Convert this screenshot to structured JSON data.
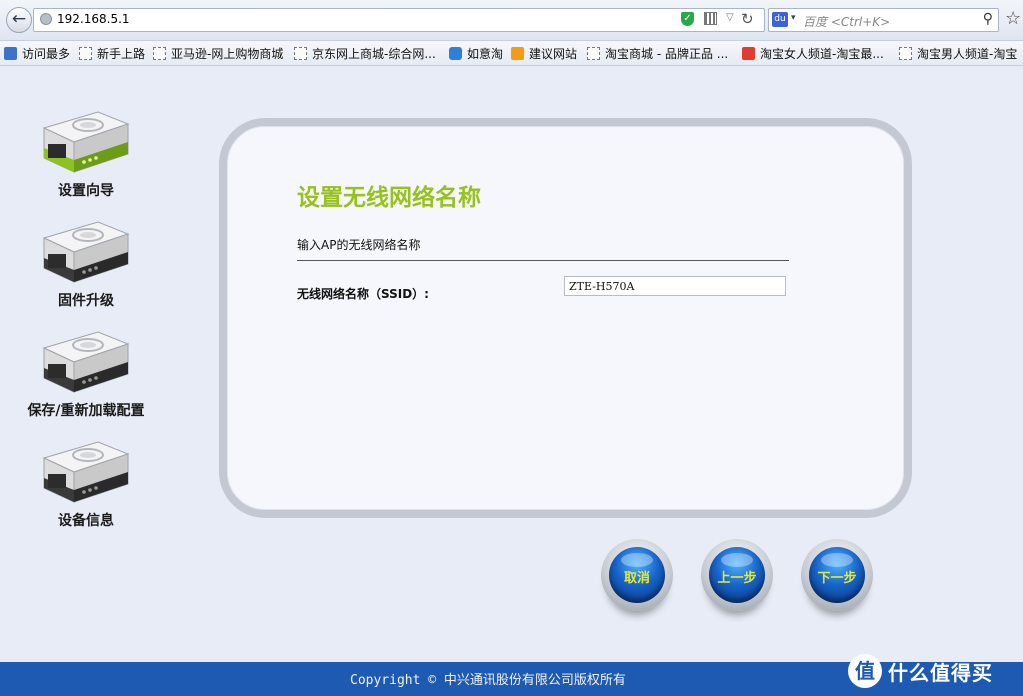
{
  "browser": {
    "url": "192.168.5.1",
    "search_placeholder": "百度 <Ctrl+K>",
    "search_engine_icon": "baidu-paw-icon"
  },
  "bookmarks": [
    {
      "label": "访问最多",
      "icon": "reader-icon"
    },
    {
      "label": "新手上路",
      "icon": "page-icon"
    },
    {
      "label": "亚马逊-网上购物商城",
      "icon": "page-icon"
    },
    {
      "label": "京东网上商城-综合网...",
      "icon": "page-icon"
    },
    {
      "label": "如意淘",
      "icon": "ruyitao-icon"
    },
    {
      "label": "建议网站",
      "icon": "bulb-icon"
    },
    {
      "label": "淘宝商城 - 品牌正品 ...",
      "icon": "page-icon"
    },
    {
      "label": "淘宝女人频道-淘宝最...",
      "icon": "taobao-icon"
    },
    {
      "label": "淘宝男人频道-淘宝",
      "icon": "page-icon"
    }
  ],
  "sidebar": {
    "items": [
      {
        "label": "设置向导",
        "active": true
      },
      {
        "label": "固件升级",
        "active": false
      },
      {
        "label": "保存/重新加载配置",
        "active": false
      },
      {
        "label": "设备信息",
        "active": false
      }
    ]
  },
  "main": {
    "title": "设置无线网络名称",
    "description": "输入AP的无线网络名称",
    "ssid_label": "无线网络名称（SSID）:",
    "ssid_value": "ZTE-H570A"
  },
  "buttons": {
    "cancel": "取消",
    "prev": "上一步",
    "next": "下一步"
  },
  "footer": {
    "copyright": "Copyright © 中兴通讯股份有限公司版权所有",
    "watermark_logo": "值",
    "watermark_text": "什么值得买"
  },
  "colors": {
    "title_green": "#97c11c",
    "footer_blue": "#1e5ab2",
    "button_label_yellow": "#e7e92d",
    "active_device_green": "#8bc321"
  }
}
